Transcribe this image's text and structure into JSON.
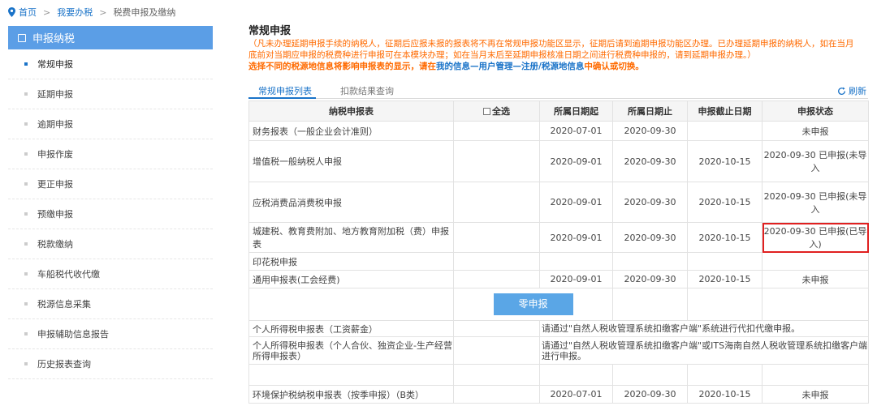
{
  "breadcrumb": {
    "home": "首页",
    "level2": "我要办税",
    "current": "税费申报及缴纳",
    "sep": ">"
  },
  "sidebar": {
    "header": "申报纳税",
    "items": [
      {
        "label": "常规申报",
        "active": true
      },
      {
        "label": "延期申报"
      },
      {
        "label": "逾期申报"
      },
      {
        "label": "申报作废"
      },
      {
        "label": "更正申报"
      },
      {
        "label": "预缴申报"
      },
      {
        "label": "税款缴纳"
      },
      {
        "label": "车船税代收代缴"
      },
      {
        "label": "税源信息采集"
      },
      {
        "label": "申报辅助信息报告"
      },
      {
        "label": "历史报表查询"
      }
    ]
  },
  "main": {
    "title": "常规申报",
    "notice1": "（凡未办理延期申报手续的纳税人，征期后应报未报的报表将不再在常规申报功能区显示，征期后请到逾期申报功能区办理。已办理延期申报的纳税人，如在当月",
    "notice2": "底前对当期应申报的税费种进行申报可在本模块办理；如在当月末后至延期申报核准日期之间进行税费种申报的，请到延期申报办理。）",
    "notice3_pre": "选择不同的税源地信息将影响申报表的显示，请在",
    "notice3_link": "我的信息—用户管理—注册/税源地信息",
    "notice3_post": "中确认或切换。",
    "tabs": [
      "常规申报列表",
      "扣款结果查询"
    ],
    "refresh": "刷新"
  },
  "table": {
    "headers": {
      "name": "纳税申报表",
      "select_all": "全选",
      "start": "所属日期起",
      "end": "所属日期止",
      "deadline": "申报截止日期",
      "status": "申报状态"
    },
    "rows": [
      {
        "name": "财务报表（一般企业会计准则）",
        "start": "2020-07-01",
        "end": "2020-09-30",
        "deadline": "",
        "status": "未申报"
      },
      {
        "name": "增值税一般纳税人申报",
        "start": "2020-09-01",
        "end": "2020-09-30",
        "deadline": "2020-10-15",
        "status": "2020-09-30 已申报(未导入"
      },
      {
        "name": "应税消费品消费税申报",
        "start": "2020-09-01",
        "end": "2020-09-30",
        "deadline": "2020-10-15",
        "status": "2020-09-30 已申报(未导入"
      },
      {
        "name": "城建税、教育费附加、地方教育附加税（费）申报表",
        "start": "2020-09-01",
        "end": "2020-09-30",
        "deadline": "2020-10-15",
        "status": "2020-09-30 已申报(已导入)"
      },
      {
        "name": "印花税申报",
        "start": "",
        "end": "",
        "deadline": "",
        "status": ""
      },
      {
        "name": "通用申报表(工会经费)",
        "start": "2020-09-01",
        "end": "2020-09-30",
        "deadline": "2020-10-15",
        "status": "未申报"
      }
    ],
    "zero_button": "零申报",
    "personal_rows": [
      {
        "name": "个人所得税申报表（工资薪金）",
        "note": "请通过\"自然人税收管理系统扣缴客户端\"系统进行代扣代缴申报。"
      },
      {
        "name": "个人所得税申报表（个人合伙、独资企业-生产经营所得申报表）",
        "note": "请通过\"自然人税收管理系统扣缴客户端\"或ITS海南自然人税收管理系统扣缴客户端进行申报。"
      }
    ],
    "last_row": {
      "name": "环境保护税纳税申报表（按季申报）（B类）",
      "start": "2020-07-01",
      "end": "2020-09-30",
      "deadline": "2020-10-15",
      "status": "未申报"
    }
  }
}
